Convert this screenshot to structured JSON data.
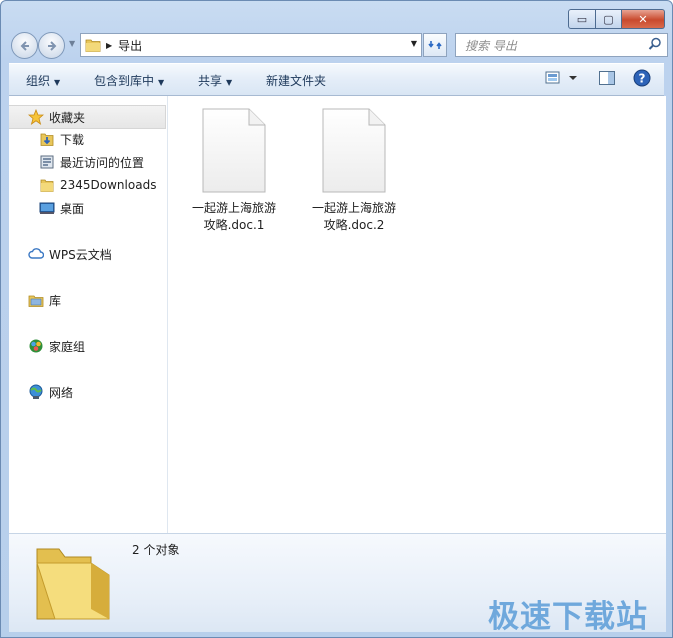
{
  "window": {
    "buttons": {
      "minimize": "▭",
      "maximize": "▢",
      "close": "✕"
    }
  },
  "address": {
    "path": "导出"
  },
  "search": {
    "placeholder": "搜索 导出"
  },
  "toolbar": {
    "organize": "组织",
    "include_library": "包含到库中",
    "share": "共享",
    "new_folder": "新建文件夹"
  },
  "sidebar": {
    "favorites": "收藏夹",
    "favorites_items": [
      "下载",
      "最近访问的位置",
      "2345Downloads",
      "桌面"
    ],
    "wps_cloud": "WPS云文档",
    "libraries": "库",
    "homegroup": "家庭组",
    "network": "网络"
  },
  "files": [
    {
      "name_line1": "一起游上海旅游",
      "name_line2": "攻略.doc.1"
    },
    {
      "name_line1": "一起游上海旅游",
      "name_line2": "攻略.doc.2"
    }
  ],
  "details": {
    "count": "2 个对象"
  },
  "watermark": "极速下载站",
  "colors": {
    "accent": "#2b6ac4",
    "window_frame": "#bcd2ee",
    "close_button": "#c94a2e",
    "watermark": "#6fa8dc"
  }
}
